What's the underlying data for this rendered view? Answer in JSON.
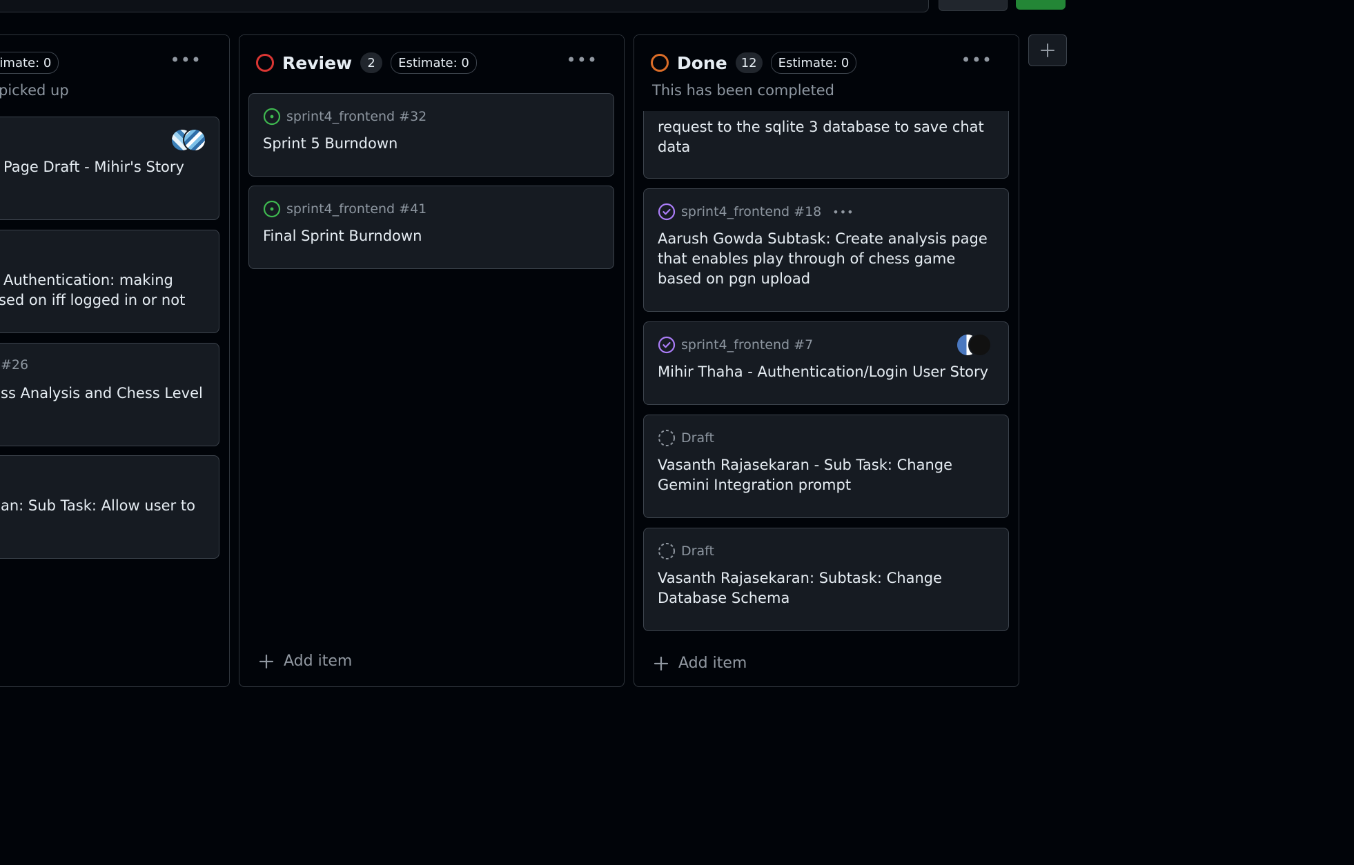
{
  "columns": {
    "in_progress": {
      "estimate": "stimate: 0",
      "description": "picked up",
      "cards": [
        {
          "title": "Page Draft - Mihir's Story"
        },
        {
          "title_line1": "Authentication: making",
          "title_line2": "sed on iff logged in or not"
        },
        {
          "meta": "#26",
          "title": "ss Analysis and Chess Level"
        },
        {
          "title": "an: Sub Task: Allow user to"
        }
      ]
    },
    "review": {
      "name": "Review",
      "count": "2",
      "estimate": "Estimate: 0",
      "status_color": "#da3633",
      "cards": [
        {
          "meta": "sprint4_frontend #32",
          "title": "Sprint 5 Burndown"
        },
        {
          "meta": "sprint4_frontend #41",
          "title": "Final Sprint Burndown"
        }
      ],
      "add_item": "Add item"
    },
    "done": {
      "name": "Done",
      "count": "12",
      "estimate": "Estimate: 0",
      "description": "This has been completed",
      "status_color": "#db6d28",
      "cards": [
        {
          "title": "request to the sqlite 3 database to save chat data"
        },
        {
          "meta": "sprint4_frontend #18",
          "title": "Aarush Gowda Subtask: Create analysis page that enables play through of chess game based on pgn upload"
        },
        {
          "meta": "sprint4_frontend #7",
          "title": "Mihir Thaha - Authentication/Login User Story"
        },
        {
          "meta": "Draft",
          "title": "Vasanth Rajasekaran - Sub Task: Change Gemini Integration prompt"
        },
        {
          "meta": "Draft",
          "title": "Vasanth Rajasekaran: Subtask: Change Database Schema"
        }
      ],
      "add_item": "Add item"
    }
  },
  "colors": {
    "background": "#010409",
    "card": "#161b22",
    "border": "#3d444d",
    "open_issue": "#3fb950",
    "closed_issue": "#ab7df8",
    "draft": "#9198a1"
  },
  "icons": [
    "open-issue-icon",
    "closed-issue-icon",
    "draft-issue-icon",
    "kebab-menu-icon",
    "plus-icon"
  ]
}
